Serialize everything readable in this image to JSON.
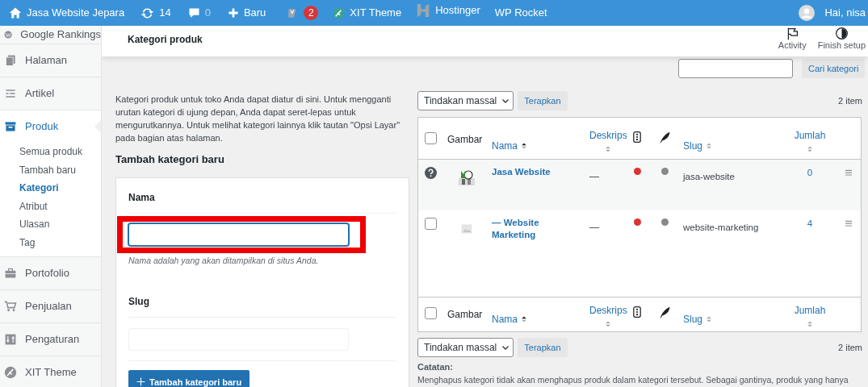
{
  "admin_bar": {
    "site_name": "Jasa Website Jepara",
    "updates_count": "14",
    "comments_count": "0",
    "new_label": "Baru",
    "seo_badge": "2",
    "theme_label": "XIT Theme",
    "hosting_label": "Hostinger",
    "cache_label": "WP Rocket",
    "greeting": "Hai, nisa"
  },
  "sidebar": {
    "items": [
      {
        "label": "Google Rankings",
        "selected": false
      },
      {
        "label": "Halaman",
        "selected": false
      },
      {
        "label": "Artikel",
        "selected": false
      },
      {
        "label": "Produk",
        "selected": true,
        "children": [
          {
            "label": "Semua produk",
            "selected": false
          },
          {
            "label": "Tambah baru",
            "selected": false
          },
          {
            "label": "Kategori",
            "selected": true
          },
          {
            "label": "Atribut",
            "selected": false
          },
          {
            "label": "Ulasan",
            "selected": false
          },
          {
            "label": "Tag",
            "selected": false
          }
        ]
      },
      {
        "label": "Portofolio",
        "selected": false
      },
      {
        "label": "Penjualan",
        "selected": false
      },
      {
        "label": "Pengaturan",
        "selected": false
      },
      {
        "label": "XIT Theme",
        "selected": false
      }
    ]
  },
  "header": {
    "title": "Kategori produk",
    "actions": [
      {
        "label": "Activity"
      },
      {
        "label": "Finish setup"
      }
    ]
  },
  "search": {
    "button": "Cari kategori"
  },
  "intro": "Kategori produk untuk toko Anda dapat diatur di sini. Untuk mengganti urutan kategori di ujung depan, Anda dapat seret-lepas untuk mengurutkannya. Untuk melihat kategori lainnya klik tautan \"Opsi Layar\" pada bagian atas halaman.",
  "form": {
    "title": "Tambah kategori baru",
    "fields": [
      {
        "label": "Nama",
        "hint": "Nama adalah yang akan ditampilkan di situs Anda.",
        "focused": true,
        "highlighted": true
      },
      {
        "label": "Slug",
        "focused": false,
        "highlighted": false
      }
    ],
    "submit": "Tambah kategori baru"
  },
  "table": {
    "bulk_action": "Tindakan massal",
    "apply": "Terapkan",
    "count": "2 item",
    "columns": [
      {
        "kind": "plain",
        "label": "Gambar"
      },
      {
        "kind": "sortable",
        "label": "Nama",
        "sorted": true
      },
      {
        "kind": "sortable",
        "label": "Deskrips",
        "sorted": false
      },
      {
        "kind": "seo"
      },
      {
        "kind": "readability"
      },
      {
        "kind": "sortable",
        "label": "Slug",
        "sorted": false
      },
      {
        "kind": "sortable",
        "label": "Jumlah",
        "sorted": false
      }
    ],
    "rows": [
      {
        "kind": "default",
        "has_image": true,
        "name": "Jasa Website",
        "description": "—",
        "statuses": [
          {
            "color": "#dd3333"
          },
          {
            "color": "#888888"
          }
        ],
        "slug": "jasa-website",
        "count": "0"
      },
      {
        "kind": "normal",
        "has_image": false,
        "name": "— Website Marketing",
        "description": "—",
        "statuses": [
          {
            "color": "#dd3333"
          },
          {
            "color": "#888888"
          }
        ],
        "slug": "website-marketing",
        "count": "4"
      }
    ],
    "header_checked": false,
    "footer_checked": false,
    "footer_columns": [
      {
        "kind": "plain",
        "label": "Gambar"
      },
      {
        "kind": "sortable",
        "label": "Nama",
        "sorted": true
      },
      {
        "kind": "sortable",
        "label": "Deskrips",
        "sorted": false
      },
      {
        "kind": "seo"
      },
      {
        "kind": "readability"
      },
      {
        "kind": "sortable",
        "label": "Slug",
        "sorted": false
      },
      {
        "kind": "sortable",
        "label": "Jumlah",
        "sorted": false
      }
    ],
    "bottom_bulk_action": "Tindakan massal",
    "bottom_apply": "Terapkan",
    "bottom_count": "2 item"
  },
  "note": {
    "title": "Catatan:",
    "text": "Menghapus kategori tidak akan menghapus produk dalam kategori tersebut. Sebagai gantinya, produk yang hanya"
  }
}
